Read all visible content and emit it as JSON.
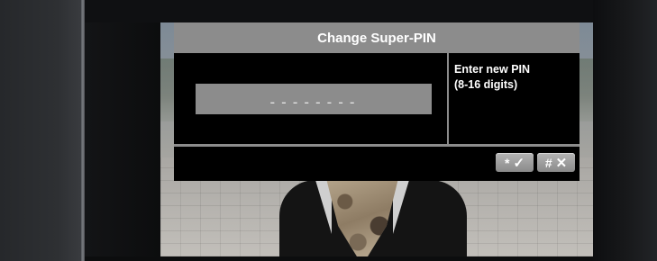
{
  "dialog": {
    "title": "Change Super-PIN",
    "pin_mask": "--------",
    "instructions": [
      "Enter new PIN",
      "(8-16 digits)"
    ]
  },
  "keys": {
    "ok": {
      "symbol": "*",
      "glyph": "✓"
    },
    "cancel": {
      "symbol": "#",
      "glyph": "✕"
    }
  },
  "colors": {
    "header": "#8c8c8c",
    "dialog_bg": "#000000",
    "text": "#ffffff"
  }
}
